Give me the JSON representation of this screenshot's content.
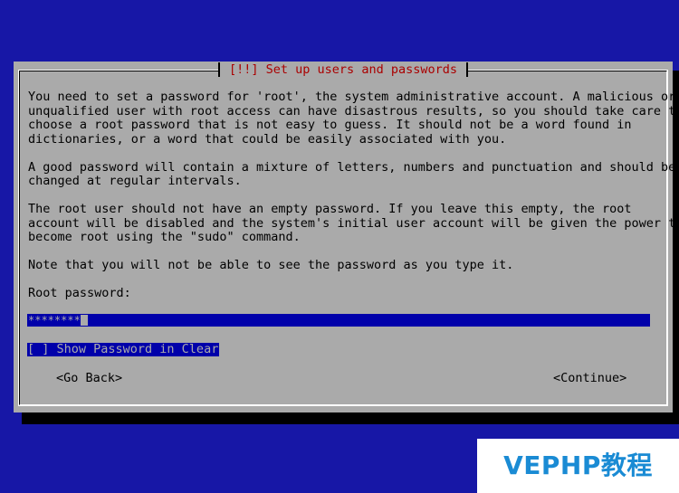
{
  "dialog": {
    "title": "[!!] Set up users and passwords",
    "paragraphs": [
      [
        "You need to set a password for 'root', the system administrative account. A malicious or",
        "unqualified user with root access can have disastrous results, so you should take care to",
        "choose a root password that is not easy to guess. It should not be a word found in",
        "dictionaries, or a word that could be easily associated with you."
      ],
      [
        "A good password will contain a mixture of letters, numbers and punctuation and should be",
        "changed at regular intervals."
      ],
      [
        "The root user should not have an empty password. If you leave this empty, the root",
        "account will be disabled and the system's initial user account will be given the power to",
        "become root using the \"sudo\" command."
      ],
      [
        "Note that you will not be able to see the password as you type it."
      ]
    ],
    "field_label": "Root password:",
    "password_mask": "********",
    "show_password_checkbox": "[ ] Show Password in Clear",
    "back_button": "<Go Back>",
    "continue_button": "<Continue>"
  },
  "watermark": "VEPHP教程",
  "colors": {
    "background": "#1717a6",
    "dialog": "#aaaaaa",
    "title": "#aa0000",
    "field": "#0000aa",
    "watermark_text": "#1a8bd4"
  }
}
